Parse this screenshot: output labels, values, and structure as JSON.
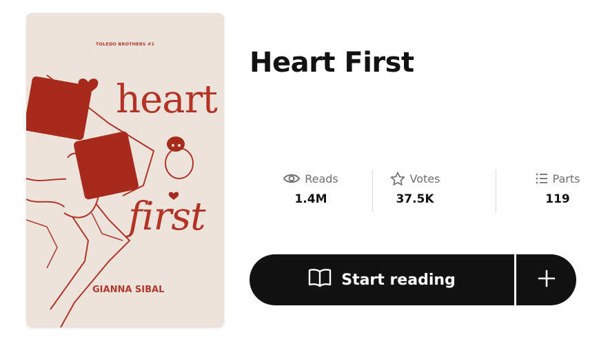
{
  "cover": {
    "series": "TOLEDO BROTHERS #1",
    "title_line1": "heart",
    "title_line2": "first",
    "author": "GIANNA SIBAL",
    "background_color": "#ece4dc",
    "accent_color": "#b43325"
  },
  "story": {
    "title": "Heart First"
  },
  "stats": [
    {
      "icon": "eye-icon",
      "label": "Reads",
      "value": "1.4M"
    },
    {
      "icon": "star-icon",
      "label": "Votes",
      "value": "37.5K"
    },
    {
      "icon": "list-icon",
      "label": "Parts",
      "value": "119"
    }
  ],
  "actions": {
    "start_label": "Start reading",
    "start_icon": "open-book-icon",
    "add_icon": "plus-icon",
    "button_color": "#121212"
  }
}
